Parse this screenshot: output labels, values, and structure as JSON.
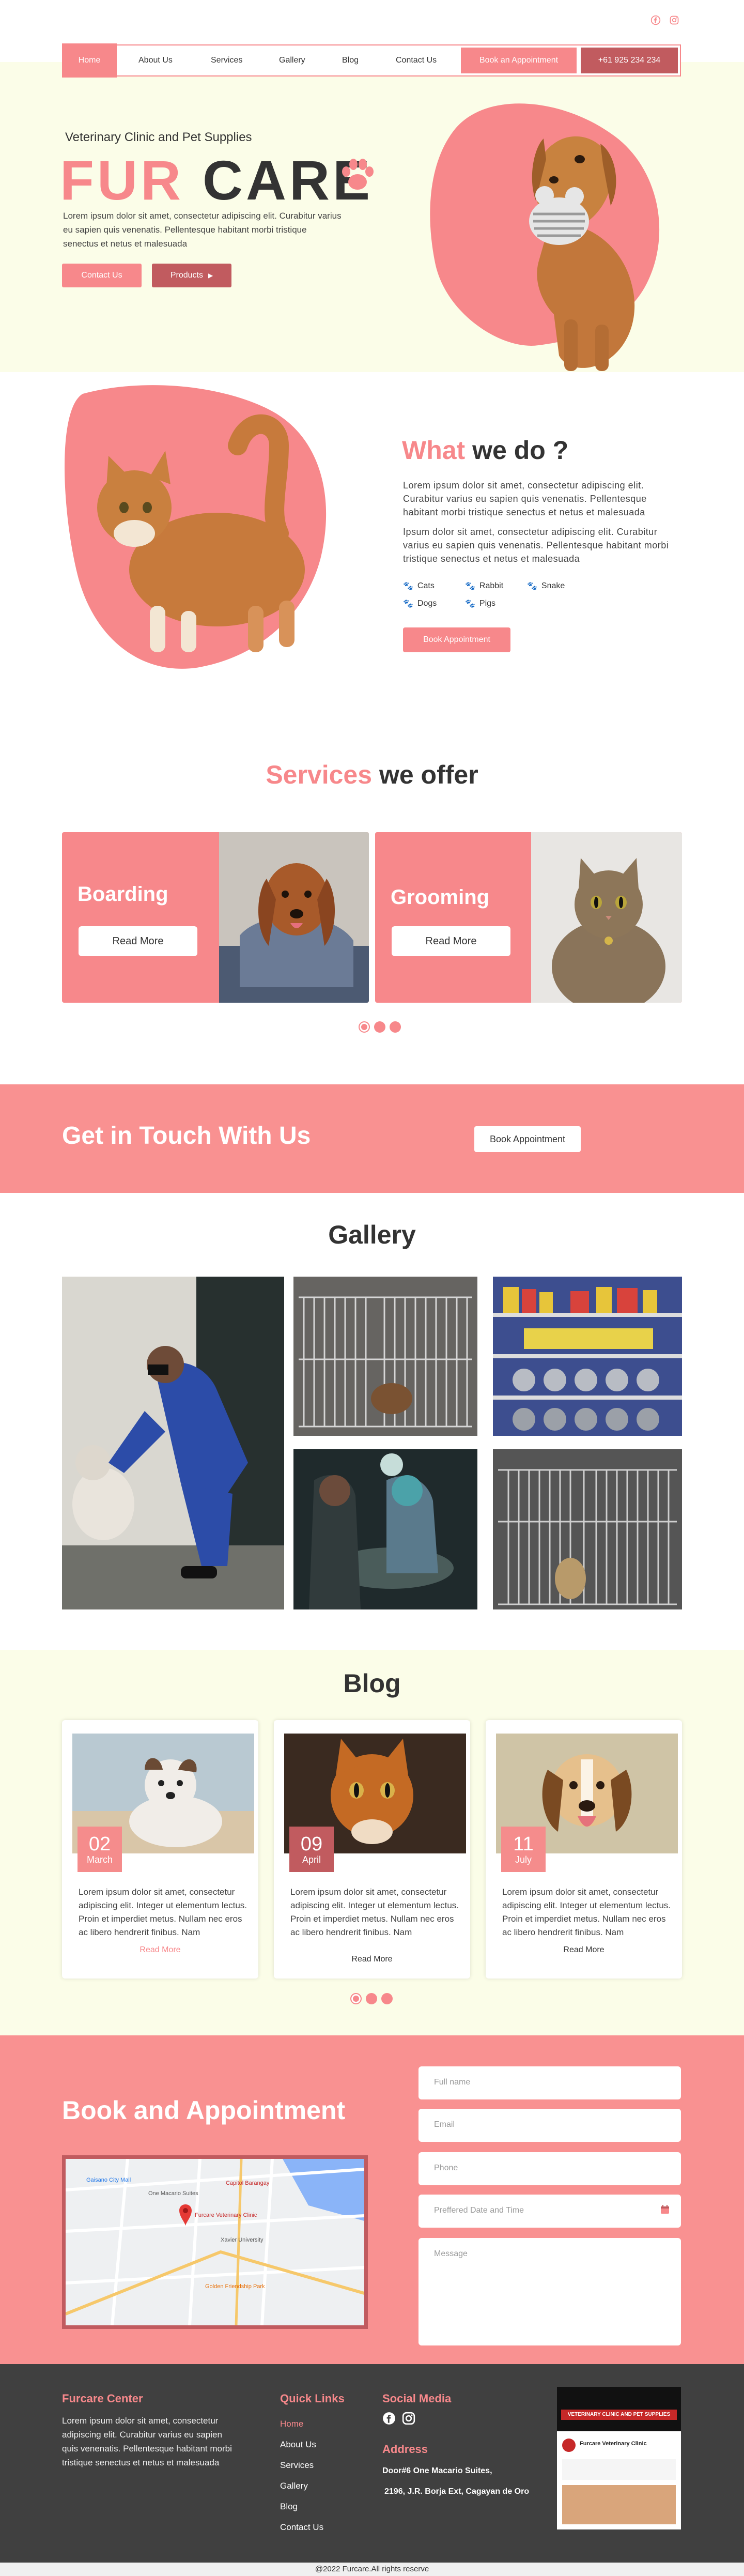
{
  "social": {
    "facebook_icon": "facebook-icon",
    "instagram_icon": "instagram-icon"
  },
  "nav": {
    "items": [
      "Home",
      "About Us",
      "Services",
      "Gallery",
      "Blog",
      "Contact Us"
    ],
    "book_label": "Book an Appointment",
    "phone": "+61 925 234 234"
  },
  "hero": {
    "subtitle": "Veterinary Clinic and Pet Supplies",
    "title_a": "FUR",
    "title_b": "CARE",
    "text": "Lorem ipsum dolor sit amet, consectetur adipiscing elit. Curabitur varius eu sapien quis venenatis. Pellentesque habitant morbi tristique senectus et netus et malesuada",
    "contact_btn": "Contact Us",
    "products_btn": "Products"
  },
  "what": {
    "title_a": "What",
    "title_b": "we do ?",
    "p1": "Lorem ipsum dolor sit amet, consectetur adipiscing elit. Curabitur varius eu sapien quis venenatis. Pellentesque habitant morbi tristique senectus et netus et malesuada",
    "p2": "Ipsum dolor sit amet, consectetur adipiscing elit. Curabitur varius eu sapien quis venenatis. Pellentesque habitant morbi tristique senectus et netus et malesuada",
    "pets": [
      "Cats",
      "Rabbit",
      "Snake",
      "Dogs",
      "Pigs"
    ],
    "book_btn": "Book Appointment"
  },
  "services": {
    "title_a": "Services",
    "title_b": "we offer",
    "cards": [
      {
        "title": "Boarding",
        "button": "Read More"
      },
      {
        "title": "Grooming",
        "button": "Read More"
      }
    ]
  },
  "touch": {
    "title": "Get in Touch With Us",
    "button": "Book Appointment"
  },
  "gallery": {
    "title": "Gallery"
  },
  "blog": {
    "title": "Blog",
    "posts": [
      {
        "day": "02",
        "month": "March",
        "text": "Lorem ipsum dolor sit amet, consectetur adipiscing elit. Integer ut elementum lectus. Proin et imperdiet metus. Nullam nec eros ac libero hendrerit finibus. Nam",
        "link": "Read More"
      },
      {
        "day": "09",
        "month": "April",
        "text": "Lorem ipsum dolor sit amet, consectetur adipiscing elit. Integer ut elementum lectus. Proin et imperdiet metus. Nullam nec eros ac libero hendrerit finibus. Nam",
        "link": "Read More"
      },
      {
        "day": "11",
        "month": "July",
        "text": "Lorem ipsum dolor sit amet, consectetur adipiscing elit. Integer ut elementum lectus. Proin et imperdiet metus. Nullam nec eros ac libero hendrerit finibus. Nam",
        "link": "Read More"
      }
    ]
  },
  "booking": {
    "title": "Book and Appointment",
    "map_labels": [
      "Furcare Veterinary Clinic",
      "Capitol Barangay",
      "Gaisano City Mall",
      "One Macario Suites",
      "Xavier University",
      "Golden Friendship Park"
    ],
    "fields": [
      "Full name",
      "Email",
      "Phone",
      "Preffered Date and Time",
      "Message"
    ]
  },
  "footer": {
    "center_title": "Furcare Center",
    "center_text": "Lorem ipsum dolor sit amet, consectetur adipiscing elit. Curabitur varius eu sapien quis venenatis. Pellentesque habitant morbi tristique senectus et netus et malesuada",
    "links_title": "Quick Links",
    "links": [
      "Home",
      "About Us",
      "Services",
      "Gallery",
      "Blog",
      "Contact Us"
    ],
    "social_title": "Social Media",
    "address_title": "Address",
    "address_1": "Door#6 One Macario Suites,",
    "address_2": "2196, J.R. Borja Ext, Cagayan de Oro",
    "fb_page_name": "Furcare Veterinary Clinic",
    "fb_banner": "VETERINARY CLINIC AND PET SUPPLIES",
    "copyright": "@2022 Furcare.All rights reserve"
  },
  "colors": {
    "accent": "#f7888b",
    "dark_accent": "#c15b5f",
    "cream": "#fbfde8",
    "footer": "#404040"
  }
}
